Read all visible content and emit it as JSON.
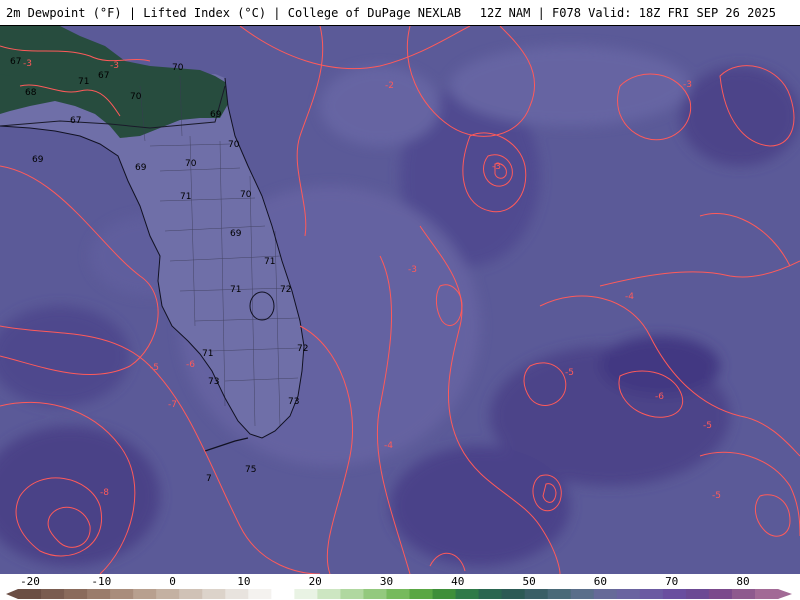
{
  "header": {
    "left_text": "2m Dewpoint (°F) | Lifted Index (°C) | College of DuPage NEXLAB",
    "right_text": "12Z NAM | F078 Valid: 18Z FRI SEP 26 2025"
  },
  "colorbar": {
    "ticks": [
      "-20",
      "-10",
      "0",
      "10",
      "20",
      "30",
      "40",
      "50",
      "60",
      "70",
      "80"
    ],
    "colors": [
      "#6b4e44",
      "#7a5c50",
      "#8a6b5c",
      "#9a7c6c",
      "#a98d7c",
      "#b8a08f",
      "#c4b1a2",
      "#d0c2b6",
      "#dcd3ca",
      "#e8e3de",
      "#f4f2ef",
      "#ffffff",
      "#e9f3e4",
      "#cde6c2",
      "#b0d8a0",
      "#93c97e",
      "#76ba5d",
      "#5aa744",
      "#3f8f3a",
      "#2f7a48",
      "#2a6650",
      "#2c5a55",
      "#3a5f66",
      "#4a6a78",
      "#5a6e8a",
      "#666a98",
      "#6a64a0",
      "#6b5aa2",
      "#6a4e9f",
      "#6c4a94",
      "#7b4a8c",
      "#8e5a8e",
      "#a26a96"
    ]
  },
  "map": {
    "ocean_color": "#5b5a98",
    "land_color": "#6f6fa8",
    "green_region_color": "#274c3e",
    "contour_color": "#ff5a5a",
    "dewpoint_labels": [
      {
        "text": "67"
      },
      {
        "text": "71"
      },
      {
        "text": "67"
      },
      {
        "text": "70"
      },
      {
        "text": "68"
      },
      {
        "text": "70"
      },
      {
        "text": "67"
      },
      {
        "text": "69"
      },
      {
        "text": "69"
      },
      {
        "text": "70"
      },
      {
        "text": "70"
      },
      {
        "text": "69"
      },
      {
        "text": "71"
      },
      {
        "text": "70"
      },
      {
        "text": "69"
      },
      {
        "text": "71"
      },
      {
        "text": "71"
      },
      {
        "text": "72"
      },
      {
        "text": "71"
      },
      {
        "text": "72"
      },
      {
        "text": "73"
      },
      {
        "text": "73"
      },
      {
        "text": "75"
      },
      {
        "text": "7"
      }
    ],
    "lifted_index_labels": [
      {
        "text": "-3"
      },
      {
        "text": "-2"
      },
      {
        "text": "-3"
      },
      {
        "text": "-3"
      },
      {
        "text": "-3"
      },
      {
        "text": "-4"
      },
      {
        "text": "-5"
      },
      {
        "text": "-6"
      },
      {
        "text": "-7"
      },
      {
        "text": "-4"
      },
      {
        "text": "-5"
      },
      {
        "text": "-6"
      },
      {
        "text": "-5"
      },
      {
        "text": "-5"
      },
      {
        "text": "-8"
      },
      {
        "text": "-3"
      }
    ]
  }
}
